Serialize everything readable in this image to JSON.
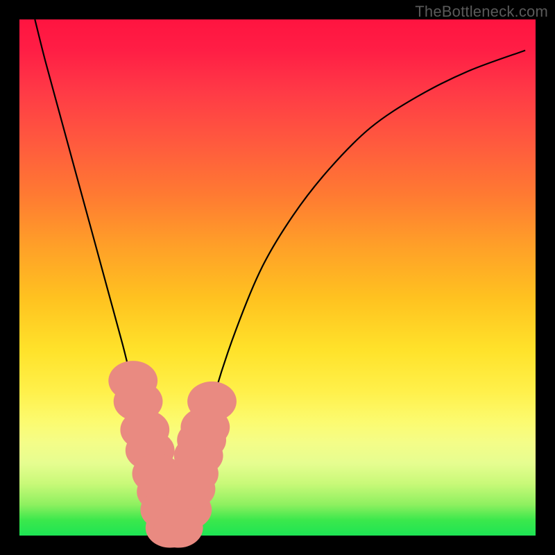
{
  "watermark": "TheBottleneck.com",
  "chart_data": {
    "type": "line",
    "title": "",
    "xlabel": "",
    "ylabel": "",
    "xlim": [
      0,
      100
    ],
    "ylim": [
      0,
      100
    ],
    "grid": false,
    "series": [
      {
        "name": "curve",
        "color": "#000000",
        "x": [
          3,
          5,
          8,
          11,
          14,
          17,
          20,
          22,
          24,
          26,
          27,
          28,
          29,
          30,
          31,
          32,
          33,
          35,
          38,
          42,
          47,
          53,
          60,
          68,
          77,
          87,
          98
        ],
        "y": [
          100,
          92,
          81,
          70,
          59,
          48,
          37,
          29,
          22,
          14,
          10,
          6,
          2,
          1,
          1,
          3,
          8,
          16,
          28,
          40,
          52,
          62,
          71,
          79,
          85,
          90,
          94
        ]
      }
    ],
    "markers": {
      "name": "dots",
      "color": "#e98a81",
      "radius": 8,
      "x": [
        22.0,
        23.0,
        24.3,
        25.3,
        26.6,
        27.5,
        28.2,
        29.2,
        30.8,
        32.5,
        33.2,
        33.8,
        34.7,
        35.3,
        36.0,
        37.3
      ],
      "y": [
        30.0,
        26.0,
        20.5,
        16.5,
        12.0,
        8.5,
        5.0,
        1.5,
        1.5,
        5.0,
        9.0,
        12.0,
        15.5,
        18.5,
        21.0,
        26.0
      ]
    }
  }
}
